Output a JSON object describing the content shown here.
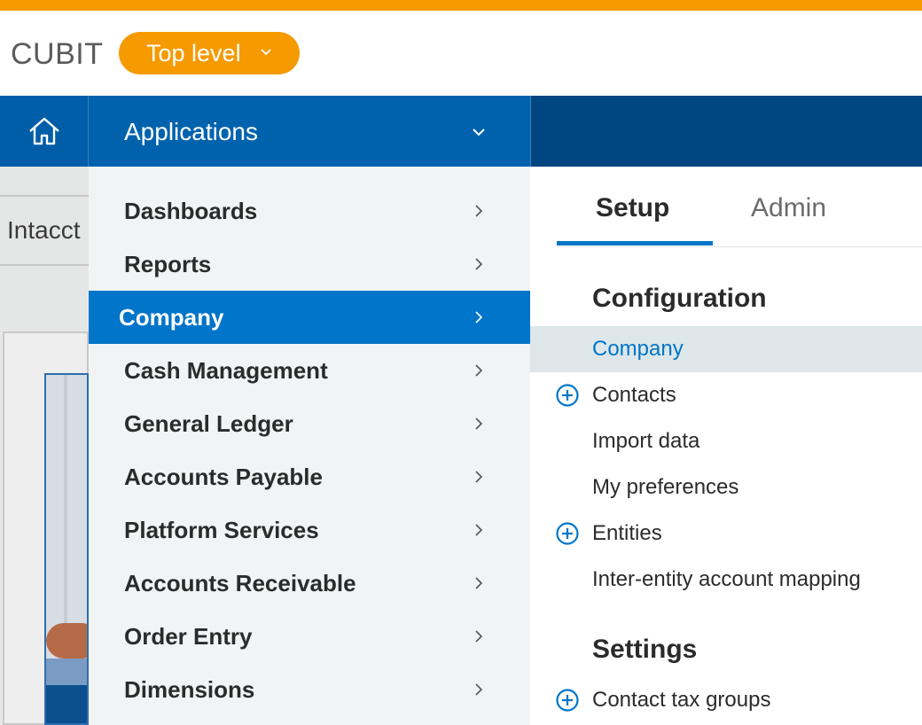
{
  "header": {
    "company_name": "CUBIT",
    "level_selector": "Top level"
  },
  "navbar": {
    "home_icon": "home-icon",
    "applications_label": "Applications"
  },
  "background_page": {
    "tab_text": "Intacct"
  },
  "menu": {
    "items": [
      {
        "label": "Dashboards",
        "active": false
      },
      {
        "label": "Reports",
        "active": false
      },
      {
        "label": "Company",
        "active": true
      },
      {
        "label": "Cash Management",
        "active": false
      },
      {
        "label": "General Ledger",
        "active": false
      },
      {
        "label": "Accounts Payable",
        "active": false
      },
      {
        "label": "Platform Services",
        "active": false
      },
      {
        "label": "Accounts Receivable",
        "active": false
      },
      {
        "label": "Order Entry",
        "active": false
      },
      {
        "label": "Dimensions",
        "active": false
      }
    ]
  },
  "submenu": {
    "tabs": [
      {
        "label": "Setup",
        "active": true
      },
      {
        "label": "Admin",
        "active": false
      }
    ],
    "sections": [
      {
        "heading": "Configuration",
        "items": [
          {
            "label": "Company",
            "selected": true,
            "add_icon": false
          },
          {
            "label": "Contacts",
            "selected": false,
            "add_icon": true
          },
          {
            "label": "Import data",
            "selected": false,
            "add_icon": false
          },
          {
            "label": "My preferences",
            "selected": false,
            "add_icon": false
          },
          {
            "label": "Entities",
            "selected": false,
            "add_icon": true
          },
          {
            "label": "Inter-entity account mapping",
            "selected": false,
            "add_icon": false
          }
        ]
      },
      {
        "heading": "Settings",
        "items": [
          {
            "label": "Contact tax groups",
            "selected": false,
            "add_icon": true
          }
        ]
      }
    ]
  },
  "colors": {
    "accent_orange": "#f59a00",
    "nav_dark_blue": "#004680",
    "nav_blue": "#0062ad",
    "active_blue": "#0075c9",
    "menu_bg": "#f0f4f5"
  }
}
